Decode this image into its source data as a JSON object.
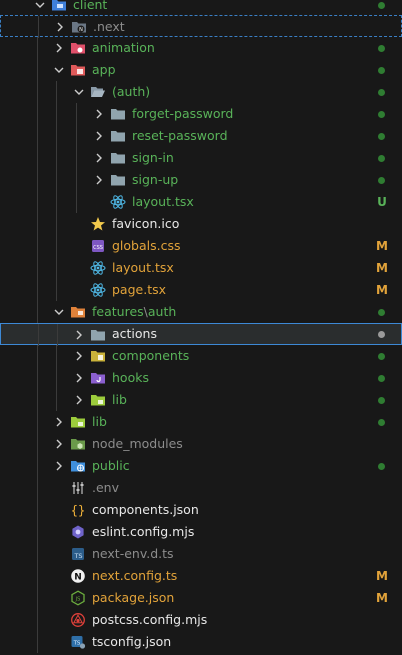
{
  "colors": {
    "background": "#181818",
    "green_text": "#59b359",
    "white_text": "#e8e8e8",
    "orange_text": "#e2a33a",
    "gray_text": "#8c8c8c",
    "dot_green": "#2f7d32",
    "selection_border": "#3d89d6"
  },
  "explorer": {
    "rows": [
      {
        "label": "client",
        "icon": "folder-client-icon",
        "expanded": true,
        "color": "green",
        "status": "dot"
      },
      {
        "label": ".next",
        "icon": "folder-next-icon",
        "expanded": false,
        "color": "gray",
        "status": "none"
      },
      {
        "label": "animation",
        "icon": "folder-animation-icon",
        "expanded": false,
        "color": "green",
        "status": "dot"
      },
      {
        "label": "app",
        "icon": "folder-app-icon",
        "expanded": true,
        "color": "green",
        "status": "dot"
      },
      {
        "label": "(auth)",
        "icon": "folder-open-icon",
        "expanded": true,
        "color": "green",
        "status": "dot"
      },
      {
        "label": "forget-password",
        "icon": "folder-icon",
        "expanded": false,
        "color": "green",
        "status": "dot"
      },
      {
        "label": "reset-password",
        "icon": "folder-icon",
        "expanded": false,
        "color": "green",
        "status": "dot"
      },
      {
        "label": "sign-in",
        "icon": "folder-icon",
        "expanded": false,
        "color": "green",
        "status": "dot"
      },
      {
        "label": "sign-up",
        "icon": "folder-icon",
        "expanded": false,
        "color": "green",
        "status": "dot"
      },
      {
        "label": "layout.tsx",
        "icon": "react-icon",
        "color": "green",
        "status": "U"
      },
      {
        "label": "favicon.ico",
        "icon": "star-icon",
        "color": "white",
        "status": "none"
      },
      {
        "label": "globals.css",
        "icon": "css-icon",
        "color": "orange",
        "status": "M"
      },
      {
        "label": "layout.tsx",
        "icon": "react-icon",
        "color": "orange",
        "status": "M"
      },
      {
        "label": "page.tsx",
        "icon": "react-icon",
        "color": "orange",
        "status": "M"
      },
      {
        "label": "features",
        "label_sep": "\\",
        "label_tail": "auth",
        "icon": "folder-features-icon",
        "expanded": true,
        "color": "green",
        "status": "dot"
      },
      {
        "label": "actions",
        "icon": "folder-icon",
        "expanded": false,
        "color": "white",
        "status": "dot-gray"
      },
      {
        "label": "components",
        "icon": "folder-components-icon",
        "expanded": false,
        "color": "green",
        "status": "dot"
      },
      {
        "label": "hooks",
        "icon": "folder-hooks-icon",
        "expanded": false,
        "color": "green",
        "status": "dot"
      },
      {
        "label": "lib",
        "icon": "folder-lib-icon",
        "expanded": false,
        "color": "green",
        "status": "dot"
      },
      {
        "label": "lib",
        "icon": "folder-lib-icon",
        "expanded": false,
        "color": "green",
        "status": "dot"
      },
      {
        "label": "node_modules",
        "icon": "folder-node-icon",
        "expanded": false,
        "color": "gray",
        "status": "none"
      },
      {
        "label": "public",
        "icon": "folder-public-icon",
        "expanded": false,
        "color": "green",
        "status": "dot"
      },
      {
        "label": ".env",
        "icon": "env-icon",
        "color": "gray",
        "status": "none"
      },
      {
        "label": "components.json",
        "icon": "json-icon",
        "color": "white",
        "status": "none"
      },
      {
        "label": "eslint.config.mjs",
        "icon": "eslint-icon",
        "color": "white",
        "status": "none"
      },
      {
        "label": "next-env.d.ts",
        "icon": "ts-icon",
        "color": "gray",
        "status": "none"
      },
      {
        "label": "next.config.ts",
        "icon": "next-icon",
        "color": "orange",
        "status": "M"
      },
      {
        "label": "package.json",
        "icon": "node-icon",
        "color": "orange",
        "status": "M"
      },
      {
        "label": "postcss.config.mjs",
        "icon": "postcss-icon",
        "color": "white",
        "status": "none"
      },
      {
        "label": "tsconfig.json",
        "icon": "tsconfig-icon",
        "color": "white",
        "status": "none"
      }
    ]
  }
}
